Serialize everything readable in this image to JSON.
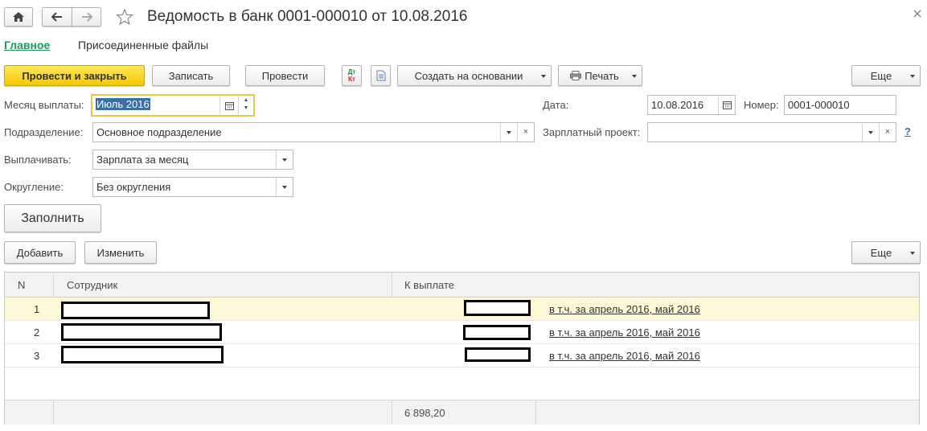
{
  "window": {
    "title": "Ведомость в банк 0001-000010 от 10.08.2016"
  },
  "tabs": {
    "main": "Главное",
    "files": "Присоединенные файлы"
  },
  "toolbar": {
    "post_close": "Провести и закрыть",
    "save": "Записать",
    "post": "Провести",
    "dtkt_top": "Дт",
    "dtkt_bottom": "Кт",
    "create_based": "Создать на основании",
    "print": "Печать",
    "more": "Еще"
  },
  "form": {
    "month_label": "Месяц выплаты:",
    "month_value": "Июль 2016",
    "date_label": "Дата:",
    "date_value": "10.08.2016",
    "number_label": "Номер:",
    "number_value": "0001-000010",
    "division_label": "Подразделение:",
    "division_value": "Основное подразделение",
    "salary_project_label": "Зарплатный проект:",
    "salary_project_value": "",
    "help": "?",
    "pay_label": "Выплачивать:",
    "pay_value": "Зарплата за месяц",
    "rounding_label": "Округление:",
    "rounding_value": "Без округления",
    "fill_button": "Заполнить"
  },
  "table_toolbar": {
    "add": "Добавить",
    "edit": "Изменить",
    "more": "Еще"
  },
  "table": {
    "columns": [
      "N",
      "Сотрудник",
      "К выплате"
    ],
    "rows": [
      {
        "n": "1",
        "note": "в т.ч. за апрель 2016, май 2016"
      },
      {
        "n": "2",
        "note": "в т.ч. за апрель 2016, май 2016"
      },
      {
        "n": "3",
        "note": "в т.ч. за апрель 2016, май 2016"
      }
    ],
    "total": "6 898,20"
  },
  "icons": {
    "home": "home-icon",
    "back": "arrow-left-icon",
    "forward": "arrow-right-icon",
    "star": "star-icon",
    "close": "close-icon",
    "printer": "printer-icon",
    "doc": "document-icon",
    "calendar": "calendar-icon"
  },
  "colors": {
    "accent_yellow": "#f5c800",
    "tab_green": "#1a9c58",
    "selected_row": "#fdf8d6",
    "focus_border": "#e8c84a"
  }
}
